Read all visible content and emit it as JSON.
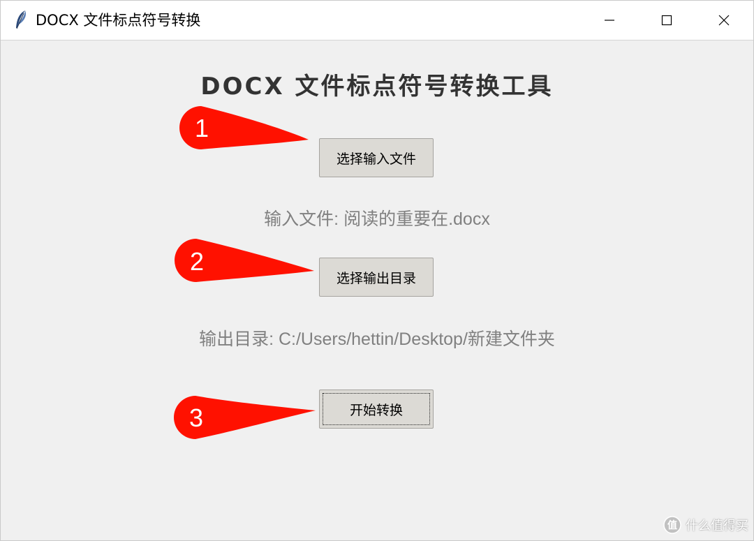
{
  "window": {
    "title": "DOCX 文件标点符号转换",
    "icon": "feather-icon",
    "controls": [
      "minimize-icon",
      "maximize-icon",
      "close-icon"
    ]
  },
  "main": {
    "heading": "DOCX 文件标点符号转换工具",
    "select_input_button": "选择输入文件",
    "input_file_label": "输入文件: 阅读的重要在.docx",
    "select_output_button": "选择输出目录",
    "output_dir_label": "输出目录: C:/Users/hettin/Desktop/新建文件夹",
    "start_button": "开始转换"
  },
  "annotations": {
    "markers": [
      "1",
      "2",
      "3"
    ],
    "color": "#ff1100"
  },
  "watermark": {
    "text": "什么值得买"
  },
  "colors": {
    "background": "#f0f0f0",
    "button": "#dcdad5",
    "label_text": "#808080",
    "heading_text": "#333333"
  }
}
